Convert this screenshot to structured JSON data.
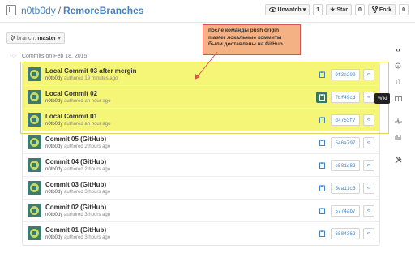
{
  "header": {
    "owner": "n0tb0dy",
    "separator": "/",
    "repo": "RemoreBranches",
    "unwatch_label": "Unwatch",
    "unwatch_count": "1",
    "star_label": "Star",
    "star_count": "0",
    "fork_label": "Fork",
    "fork_count": "0"
  },
  "branch": {
    "prefix": "branch:",
    "name": "master"
  },
  "annotation": {
    "text": "после команды push origin master локальные коммиты были доставлены на GitHub"
  },
  "tooltip": {
    "text": "Wiki"
  },
  "commits": {
    "day_label": "Commits on Feb 18, 2015",
    "items": [
      {
        "title": "Local Commit 03 after mergin",
        "author": "n0tb0dy",
        "verb": "authored",
        "time": "19 minutes ago",
        "sha": "9f3e200",
        "highlighted": true
      },
      {
        "title": "Local Commit 02",
        "author": "n0tb0dy",
        "verb": "authored",
        "time": "an hour ago",
        "sha": "7bf49cd",
        "highlighted": true
      },
      {
        "title": "Local Commit 01",
        "author": "n0tb0dy",
        "verb": "authored",
        "time": "an hour ago",
        "sha": "d4753f7",
        "highlighted": true
      },
      {
        "title": "Commit 05 (GitHub)",
        "author": "n0tb0dy",
        "verb": "authored",
        "time": "2 hours ago",
        "sha": "546a797",
        "highlighted": false
      },
      {
        "title": "Commit 04 (GitHub)",
        "author": "n0tb0dy",
        "verb": "authored",
        "time": "2 hours ago",
        "sha": "e581d89",
        "highlighted": false
      },
      {
        "title": "Commit 03 (GitHub)",
        "author": "n0tb0dy",
        "verb": "authored",
        "time": "3 hours ago",
        "sha": "5ea11c6",
        "highlighted": false
      },
      {
        "title": "Commit 02 (GitHub)",
        "author": "n0tb0dy",
        "verb": "authored",
        "time": "3 hours ago",
        "sha": "5774ab7",
        "highlighted": false
      },
      {
        "title": "Commit 01 (GitHub)",
        "author": "n0tb0dy",
        "verb": "authored",
        "time": "3 hours ago",
        "sha": "6584362",
        "highlighted": false
      }
    ]
  },
  "colors": {
    "highlight": "#f5f578",
    "link": "#4183c4",
    "annotation_bg": "#f4b183",
    "annotation_border": "#d9534f"
  },
  "sidebar_icons": [
    "code-icon",
    "issues-icon",
    "pull-request-icon",
    "wiki-icon",
    "pulse-icon",
    "graphs-icon",
    "settings-icon"
  ]
}
